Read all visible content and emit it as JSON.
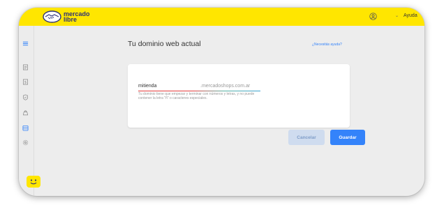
{
  "header": {
    "logo_line1": "mercado",
    "logo_line2": "libre",
    "help_label": "Ayuda",
    "icons": [
      "handshake-logo-icon",
      "user-icon",
      "chevron-down-icon"
    ]
  },
  "sidebar": {
    "items": [
      {
        "icon": "menu-icon"
      },
      {
        "icon": "receipt-icon"
      },
      {
        "icon": "money-icon"
      },
      {
        "icon": "shield-icon"
      },
      {
        "icon": "bag-icon"
      },
      {
        "icon": "store-icon"
      },
      {
        "icon": "settings-icon"
      }
    ]
  },
  "main": {
    "title": "Tu dominio web actual",
    "help_link": "¿Necesitás ayuda?",
    "domain": {
      "value": "mitienda",
      "suffix": ".mercadoshops.com.ar",
      "hint": "Tu dominio tiene que empezar y terminar con números y letras, y no puede contener la letra \"ñ\" o caracteres especiales."
    },
    "buttons": {
      "cancel": "Cancelar",
      "save": "Guardar"
    }
  },
  "colors": {
    "brand_yellow": "#ffe600",
    "primary_blue": "#3483fa",
    "cancel_bg": "#cfdcef",
    "underline_error": "#e03a3a",
    "underline_ok": "#3aa0d0"
  }
}
